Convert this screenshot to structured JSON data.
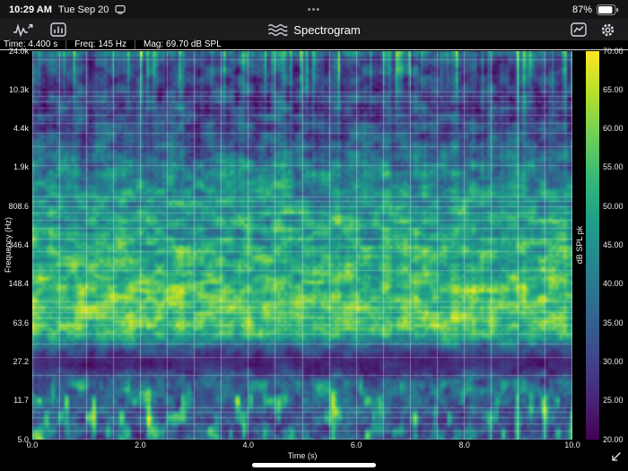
{
  "app": {
    "name": "Spectrogram"
  },
  "status_bar": {
    "time": "10:29 AM",
    "date": "Tue Sep 20",
    "multitask": "•••",
    "battery_percent": "87%"
  },
  "toolbar": {
    "title": "Spectrogram"
  },
  "readout": {
    "time": "Time: 4.400 s",
    "freq": "Freq: 145 Hz",
    "mag": "Mag: 69.70 dB SPL"
  },
  "chart_data": {
    "type": "heatmap",
    "title": "Spectrogram",
    "xlabel": "Time (s)",
    "ylabel": "Frequency (Hz)",
    "x_range_s": [
      0,
      10
    ],
    "x_tick_labels": [
      "0.0",
      "2.0",
      "4.0",
      "6.0",
      "8.0",
      "10.0"
    ],
    "x_grid_step_s": 0.5,
    "y_scale": "log",
    "y_range_hz": [
      5,
      24000
    ],
    "y_tick_labels": [
      "24.0k",
      "10.3k",
      "4.4k",
      "1.9k",
      "808.6",
      "346.4",
      "148.4",
      "63.6",
      "27.2",
      "11.7",
      "5.0"
    ],
    "grid": true,
    "colorbar": {
      "label": "dB SPL pk",
      "range_db": [
        20,
        70
      ],
      "tick_labels": [
        "70.00",
        "65.00",
        "60.00",
        "55.00",
        "50.00",
        "45.00",
        "40.00",
        "35.00",
        "30.00",
        "25.00",
        "20.00"
      ],
      "colormap": "viridis"
    },
    "cursor": {
      "time_s": 4.4,
      "freq_hz": 145,
      "magnitude_db_spl": 69.7
    }
  },
  "colors": {
    "toolbar_bg": "#1d1d20",
    "background": "#000000",
    "grid_line": "rgba(255,255,255,0.34)"
  }
}
